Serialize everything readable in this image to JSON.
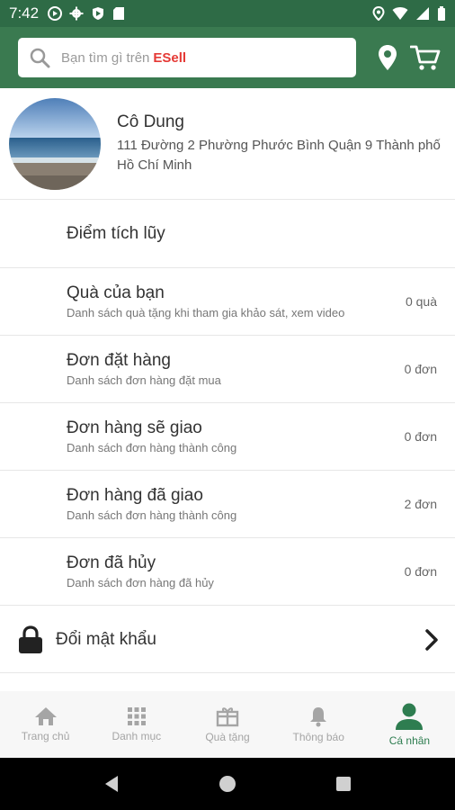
{
  "status_bar": {
    "time": "7:42"
  },
  "search": {
    "placeholder": "Bạn tìm gì trên",
    "brand": "ESell"
  },
  "profile": {
    "name": "Cô Dung",
    "address": "111 Đường 2 Phường Phước Bình Quận 9 Thành phố Hồ Chí Minh"
  },
  "menu": [
    {
      "title": "Điểm tích lũy",
      "subtitle": "",
      "count": ""
    },
    {
      "title": "Quà của bạn",
      "subtitle": "Danh sách quà tặng khi tham gia khảo sát, xem video",
      "count": "0 quà"
    },
    {
      "title": "Đơn đặt hàng",
      "subtitle": "Danh sách đơn hàng đặt mua",
      "count": "0 đơn"
    },
    {
      "title": "Đơn hàng sẽ giao",
      "subtitle": "Danh sách đơn hàng thành công",
      "count": "0 đơn"
    },
    {
      "title": "Đơn hàng đã giao",
      "subtitle": "Danh sách đơn hàng thành công",
      "count": "2 đơn"
    },
    {
      "title": "Đơn đã hủy",
      "subtitle": "Danh sách đơn hàng đã hủy",
      "count": "0 đơn"
    }
  ],
  "change_password": {
    "label": "Đổi mật khẩu"
  },
  "bottom_nav": [
    {
      "label": "Trang chủ",
      "icon": "home-icon"
    },
    {
      "label": "Danh mục",
      "icon": "grid-icon"
    },
    {
      "label": "Quà tặng",
      "icon": "gift-icon"
    },
    {
      "label": "Thông báo",
      "icon": "bell-icon"
    },
    {
      "label": "Cá nhân",
      "icon": "person-icon",
      "active": true
    }
  ],
  "colors": {
    "header": "#3a7a50",
    "status_bar": "#2e6b46",
    "brand": "#e53935",
    "active_nav": "#2e7d50"
  }
}
